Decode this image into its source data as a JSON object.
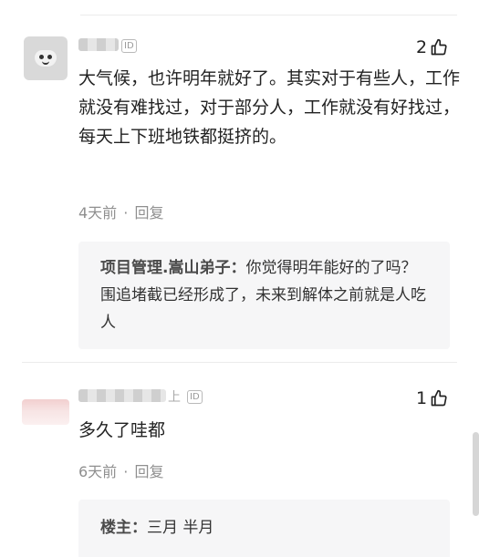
{
  "comments": [
    {
      "likes": "2",
      "id_badge": "ID",
      "text": "大气候，也许明年就好了。其实对于有些人，工作就没有难找过，对于部分人，工作就没有好找过，每天上下班地铁都挺挤的。",
      "time": "4天前",
      "separator": "·",
      "reply_label": "回复",
      "reply": {
        "author": "项目管理.嵩山弟子：",
        "text": "你觉得明年能好的了吗？围追堵截已经形成了，未来到解体之前就是人吃人"
      }
    },
    {
      "likes": "1",
      "id_badge": "ID",
      "name_suffix": "上",
      "text": "多久了哇都",
      "time": "6天前",
      "separator": "·",
      "reply_label": "回复",
      "reply": {
        "author": "楼主：",
        "text": "三月 半月"
      }
    }
  ],
  "icons": {
    "like": "thumbs-up-icon"
  },
  "colors": {
    "meta": "#8f8f8f",
    "reply_bg": "#f6f6f7",
    "text": "#222222"
  }
}
